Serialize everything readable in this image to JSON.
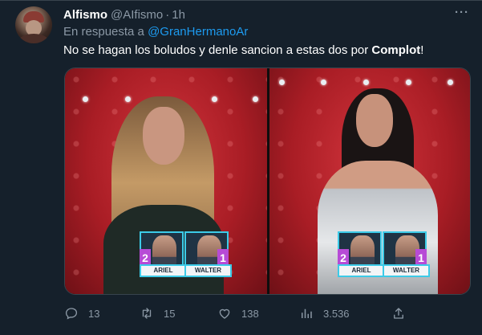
{
  "tweet": {
    "display_name": "Alfismo",
    "handle": "@AIfismo",
    "separator": "·",
    "time": "1h",
    "more_label": "···",
    "reply_prefix": "En respuesta a",
    "reply_mention": "@GranHermanoAr",
    "text_plain": "No se hagan los boludos y denle sancion a estas dos por ",
    "text_bold": "Complot",
    "text_end": "!"
  },
  "media": {
    "left_tag": {
      "num_left": "2",
      "num_right": "1",
      "label_left": "ARIEL",
      "label_right": "WALTER"
    },
    "right_tag": {
      "num_left": "2",
      "num_right": "1",
      "label_left": "ARIEL",
      "label_right": "WALTER"
    }
  },
  "actions": {
    "replies": "13",
    "retweets": "15",
    "likes": "138",
    "views": "3.536"
  },
  "icons": {
    "reply": "reply-icon",
    "retweet": "retweet-icon",
    "like": "heart-icon",
    "views": "analytics-icon",
    "share": "share-icon"
  },
  "colors": {
    "background": "#15202b",
    "secondary_text": "#8b98a5",
    "link": "#1d9bf0",
    "tag_purple": "#b74bd6",
    "tag_cyan": "#3ccbe8"
  }
}
